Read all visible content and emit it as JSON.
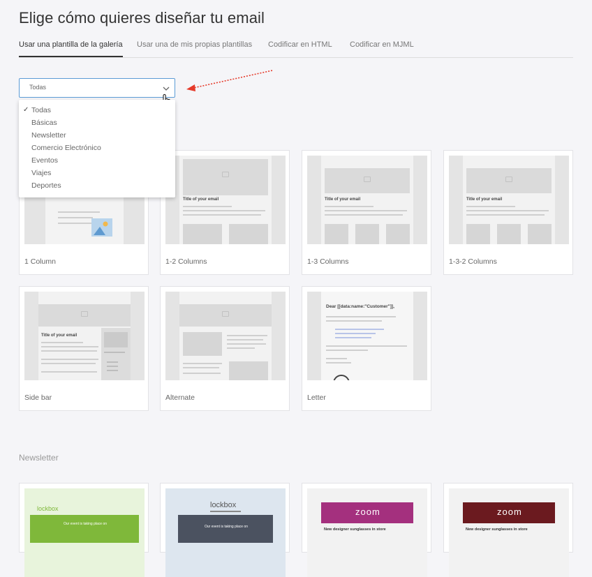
{
  "page": {
    "title": "Elige cómo quieres diseñar tu email"
  },
  "tabs": [
    {
      "label": "Usar una plantilla de la galería",
      "active": true
    },
    {
      "label": "Usar una de mis propias plantillas",
      "active": false
    },
    {
      "label": "Codificar en HTML",
      "active": false
    },
    {
      "label": "Codificar en MJML",
      "active": false
    }
  ],
  "filter": {
    "value": "Todas",
    "options": [
      "Todas",
      "Básicas",
      "Newsletter",
      "Comercio Electrónico",
      "Eventos",
      "Viajes",
      "Deportes"
    ],
    "selected_index": 0
  },
  "templates": [
    {
      "label": "1 Column"
    },
    {
      "label": "1-2 Columns"
    },
    {
      "label": "1-3 Columns"
    },
    {
      "label": "1-3-2 Columns"
    },
    {
      "label": "Side bar"
    },
    {
      "label": "Alternate"
    },
    {
      "label": "Letter"
    }
  ],
  "thumb_text": {
    "title": "Title of your email",
    "letter_title": "Dear [[data:name:\"Customer\"]],",
    "lockbox_logo": "lockbox",
    "zoom_logo": "zoom",
    "promo_text": "New designer sunglasses in store",
    "event_text": "Our event is taking place on"
  },
  "newsletter": {
    "section_title": "Newsletter"
  },
  "colors": {
    "accent_select": "#5b9bd5",
    "arrow": "#e53a2a",
    "lockbox_green": "#7fb83a",
    "zoom_purple": "#a4307e",
    "zoom_dark": "#6b1a1f"
  },
  "icons": [
    "chevron-down-icon",
    "hand-cursor-icon",
    "check-icon",
    "image-placeholder-icon"
  ]
}
